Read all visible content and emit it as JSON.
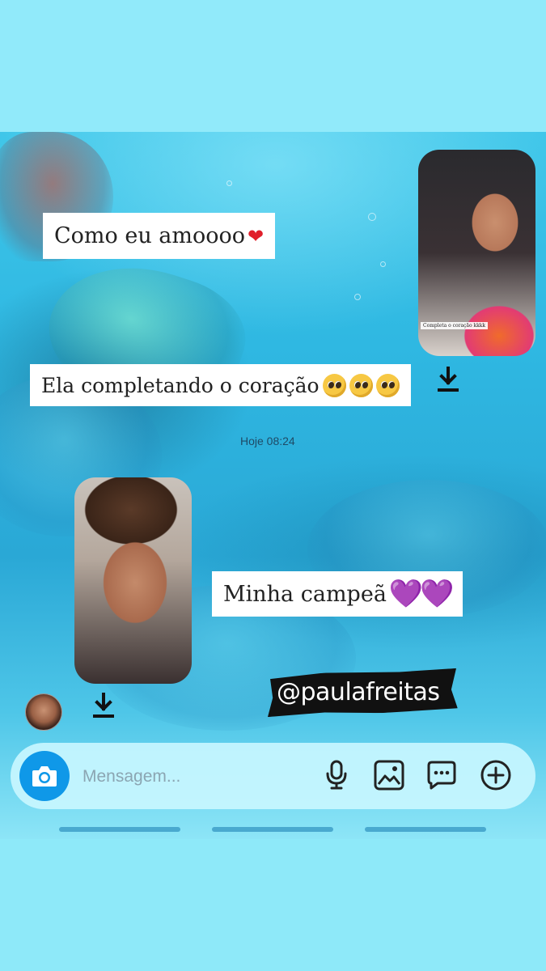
{
  "messages": [
    {
      "id": "msg1",
      "text": "Como eu amoooo",
      "emoji": "❤"
    },
    {
      "id": "msg2",
      "text": "Ela completando o coração",
      "emoji_count": 3
    },
    {
      "id": "msg3",
      "text": "Minha campeã",
      "emoji": "💜💜"
    }
  ],
  "photo_caption": "Completa o coração kkkk",
  "timestamp": "Hoje 08:24",
  "tag": "@paulafreitas",
  "composer": {
    "placeholder": "Mensagem..."
  },
  "colors": {
    "accent": "#0f98e8",
    "background": "#8ce8f8",
    "nav_line": "#49a9cf"
  },
  "icons": [
    "camera-icon",
    "microphone-icon",
    "gallery-icon",
    "chat-bubble-icon",
    "plus-icon",
    "download-icon"
  ]
}
